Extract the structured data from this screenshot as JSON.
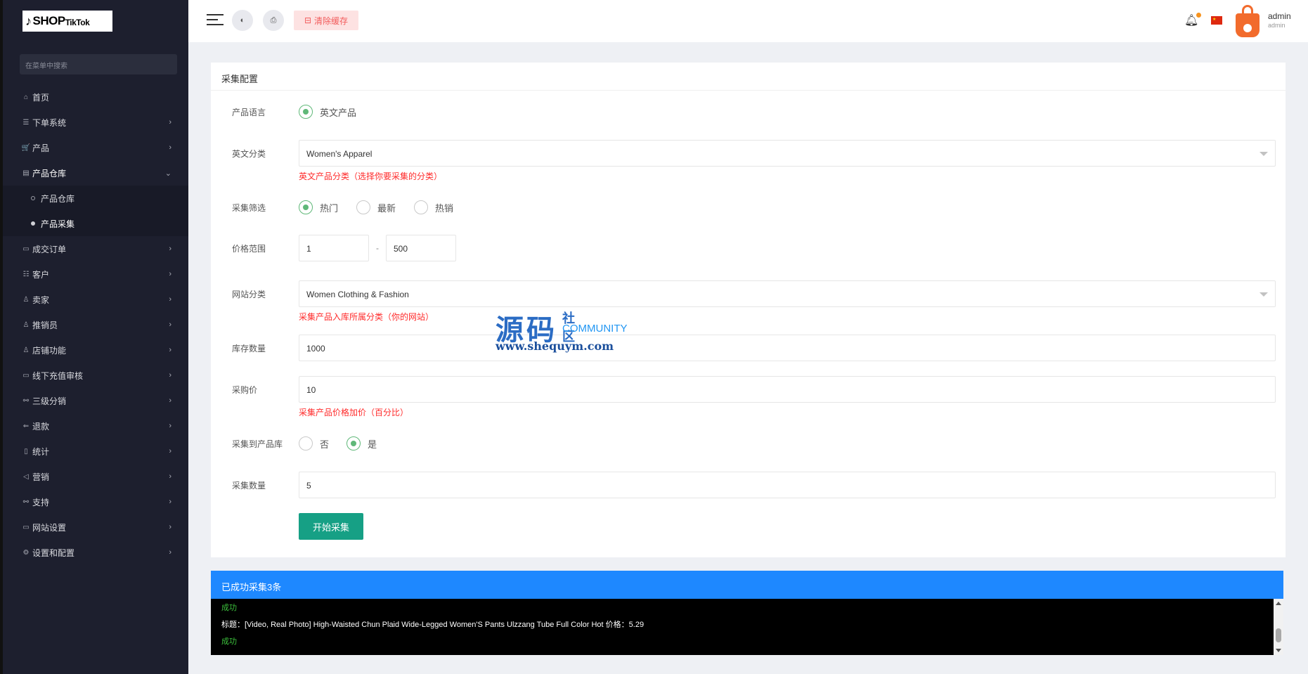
{
  "logo": {
    "main": "SHOP",
    "small": "TikTok",
    "note": "♪"
  },
  "sidebar": {
    "search_placeholder": "在菜单中搜索",
    "items": [
      {
        "icon": "⌂",
        "label": "首页",
        "arrow": ""
      },
      {
        "icon": "☰",
        "label": "下单系统",
        "arrow": "›"
      },
      {
        "icon": "🛒",
        "label": "产品",
        "arrow": "›"
      },
      {
        "icon": "▤",
        "label": "产品仓库",
        "arrow": "⌄"
      },
      {
        "label": "产品仓库"
      },
      {
        "label": "产品采集"
      },
      {
        "icon": "▭",
        "label": "成交订单",
        "arrow": "›"
      },
      {
        "icon": "☷",
        "label": "客户",
        "arrow": "›"
      },
      {
        "icon": "♙",
        "label": "卖家",
        "arrow": "›"
      },
      {
        "icon": "♙",
        "label": "推销员",
        "arrow": "›"
      },
      {
        "icon": "♙",
        "label": "店铺功能",
        "arrow": "›"
      },
      {
        "icon": "▭",
        "label": "线下充值审核",
        "arrow": "›"
      },
      {
        "icon": "⚯",
        "label": "三级分销",
        "arrow": "›"
      },
      {
        "icon": "⇐",
        "label": "退款",
        "arrow": "›"
      },
      {
        "icon": "▯",
        "label": "统计",
        "arrow": "›"
      },
      {
        "icon": "◁",
        "label": "营销",
        "arrow": "›"
      },
      {
        "icon": "⚯",
        "label": "支持",
        "arrow": "›"
      },
      {
        "icon": "▭",
        "label": "网站设置",
        "arrow": "›"
      },
      {
        "icon": "⚙",
        "label": "设置和配置",
        "arrow": "›"
      }
    ]
  },
  "topbar": {
    "clear_cache": "清除缓存",
    "user_name": "admin",
    "user_role": "admin"
  },
  "form": {
    "card_title": "采集配置",
    "lang_label": "产品语言",
    "lang_option": "英文产品",
    "en_cat_label": "英文分类",
    "en_cat_value": "Women's Apparel",
    "en_cat_hint": "英文产品分类（选择你要采集的分类）",
    "filter_label": "采集筛选",
    "filter_options": [
      "热门",
      "最新",
      "热销"
    ],
    "price_label": "价格范围",
    "price_min": "1",
    "price_dash": "-",
    "price_max": "500",
    "site_cat_label": "网站分类",
    "site_cat_value": "Women Clothing & Fashion",
    "site_cat_hint": "采集产品入库所属分类（你的网站）",
    "stock_label": "库存数量",
    "stock_value": "1000",
    "markup_label": "采购价",
    "markup_value": "10",
    "markup_hint": "采集产品价格加价（百分比）",
    "to_lib_label": "采集到产品库",
    "to_lib_options": [
      "否",
      "是"
    ],
    "count_label": "采集数量",
    "count_value": "5",
    "start_button": "开始采集"
  },
  "watermark": {
    "big": "源码",
    "sq": "社区",
    "comm": "COMMUNITY",
    "url": "www.shequym.com"
  },
  "result": {
    "header": "已成功采集3条",
    "lines": [
      {
        "type": "ok",
        "text": "成功"
      },
      {
        "type": "title",
        "text": "标题：[Video, Real Photo] High-Waisted Chun Plaid Wide-Legged Women'S Pants Ulzzang Tube Full Color Hot  价格：5.29"
      },
      {
        "type": "ok",
        "text": "成功"
      }
    ]
  }
}
